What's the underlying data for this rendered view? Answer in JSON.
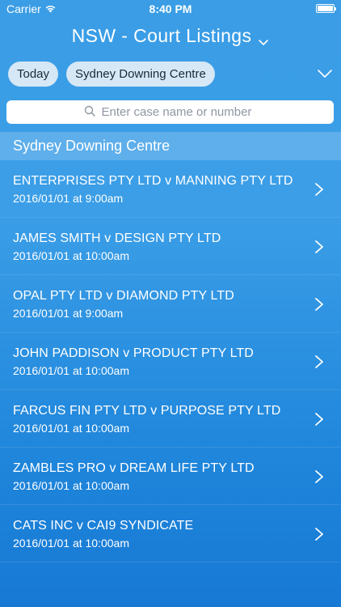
{
  "status_bar": {
    "carrier": "Carrier",
    "time": "8:40 PM",
    "wifi_icon": "wifi-icon",
    "battery_icon": "battery-icon",
    "battery_level": 1.0
  },
  "header": {
    "title": "NSW - Court Listings",
    "dropdown_icon": "chevron-down-icon"
  },
  "filters": {
    "chips": [
      "Today",
      "Sydney Downing Centre"
    ],
    "expand_icon": "chevron-down-icon"
  },
  "search": {
    "placeholder": "Enter case name or number",
    "value": "",
    "icon": "search-icon"
  },
  "section": {
    "title": "Sydney Downing Centre"
  },
  "cases": [
    {
      "title": "ENTERPRISES PTY LTD v MANNING PTY LTD",
      "datetime": "2016/01/01 at 9:00am"
    },
    {
      "title": "JAMES SMITH v DESIGN PTY LTD",
      "datetime": "2016/01/01 at 10:00am"
    },
    {
      "title": "OPAL PTY LTD v DIAMOND PTY LTD",
      "datetime": "2016/01/01 at 9:00am"
    },
    {
      "title": "JOHN PADDISON v PRODUCT PTY LTD",
      "datetime": "2016/01/01 at 10:00am"
    },
    {
      "title": "FARCUS FIN PTY LTD v PURPOSE PTY LTD",
      "datetime": "2016/01/01 at 10:00am"
    },
    {
      "title": "ZAMBLES PRO v DREAM LIFE PTY LTD",
      "datetime": "2016/01/01 at 10:00am"
    },
    {
      "title": "CATS INC v CAI9 SYNDICATE",
      "datetime": "2016/01/01 at 10:00am"
    }
  ],
  "colors": {
    "background_top": "#3a9de6",
    "background_bottom": "#1779d4",
    "chip_background": "#d6e7f5",
    "chip_text": "#1a2a3a",
    "text": "#ffffff"
  }
}
